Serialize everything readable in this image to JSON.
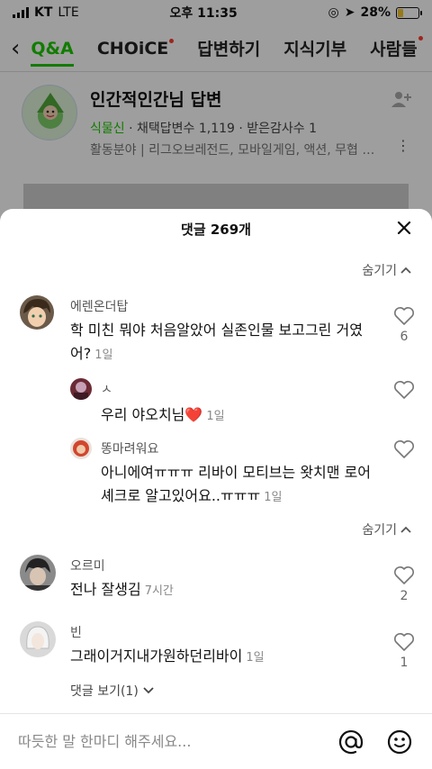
{
  "status_bar": {
    "carrier": "KT",
    "network": "LTE",
    "time": "오후 11:35",
    "battery": "28%"
  },
  "background": {
    "tabs": [
      "Q&A",
      "CHOiCE",
      "답변하기",
      "지식기부",
      "사람들"
    ],
    "profile": {
      "name": "인간적인간님 답변",
      "rank": "식물신",
      "stats": "· 채택답변수 1,119 · 받은감사수 1",
      "field": "활동분야 | 리그오브레전드, 모바일게임, 액션, 무협 …"
    }
  },
  "sheet": {
    "title": "댓글 269개",
    "hide_label": "숨기기"
  },
  "comments": [
    {
      "author": "에렌온더탑",
      "text": "학 미친 뭐야 처음알았어 실존인물 보고그린 거였어?",
      "time": "1일",
      "likes": "6"
    },
    {
      "author": "ㅅ",
      "text": "우리 야오치님❤️",
      "time": "1일"
    },
    {
      "author": "똥마려워요",
      "text": "아니에여ㅠㅠㅠ 리바이 모티브는 왓치맨 로어셰크로 알고있어요..ㅠㅠㅠ",
      "time": "1일"
    },
    {
      "author": "오르미",
      "text": "전나 잘생김",
      "time": "7시간",
      "likes": "2"
    },
    {
      "author": "빈",
      "text": "그래이거지내가원하던리바이",
      "time": "1일",
      "likes": "1"
    }
  ],
  "view_replies": "댓글 보기(1)",
  "input": {
    "placeholder": "따듯한 말 한마디 해주세요..."
  },
  "colors": {
    "accent": "#1ec800",
    "heart": "#e02424"
  }
}
